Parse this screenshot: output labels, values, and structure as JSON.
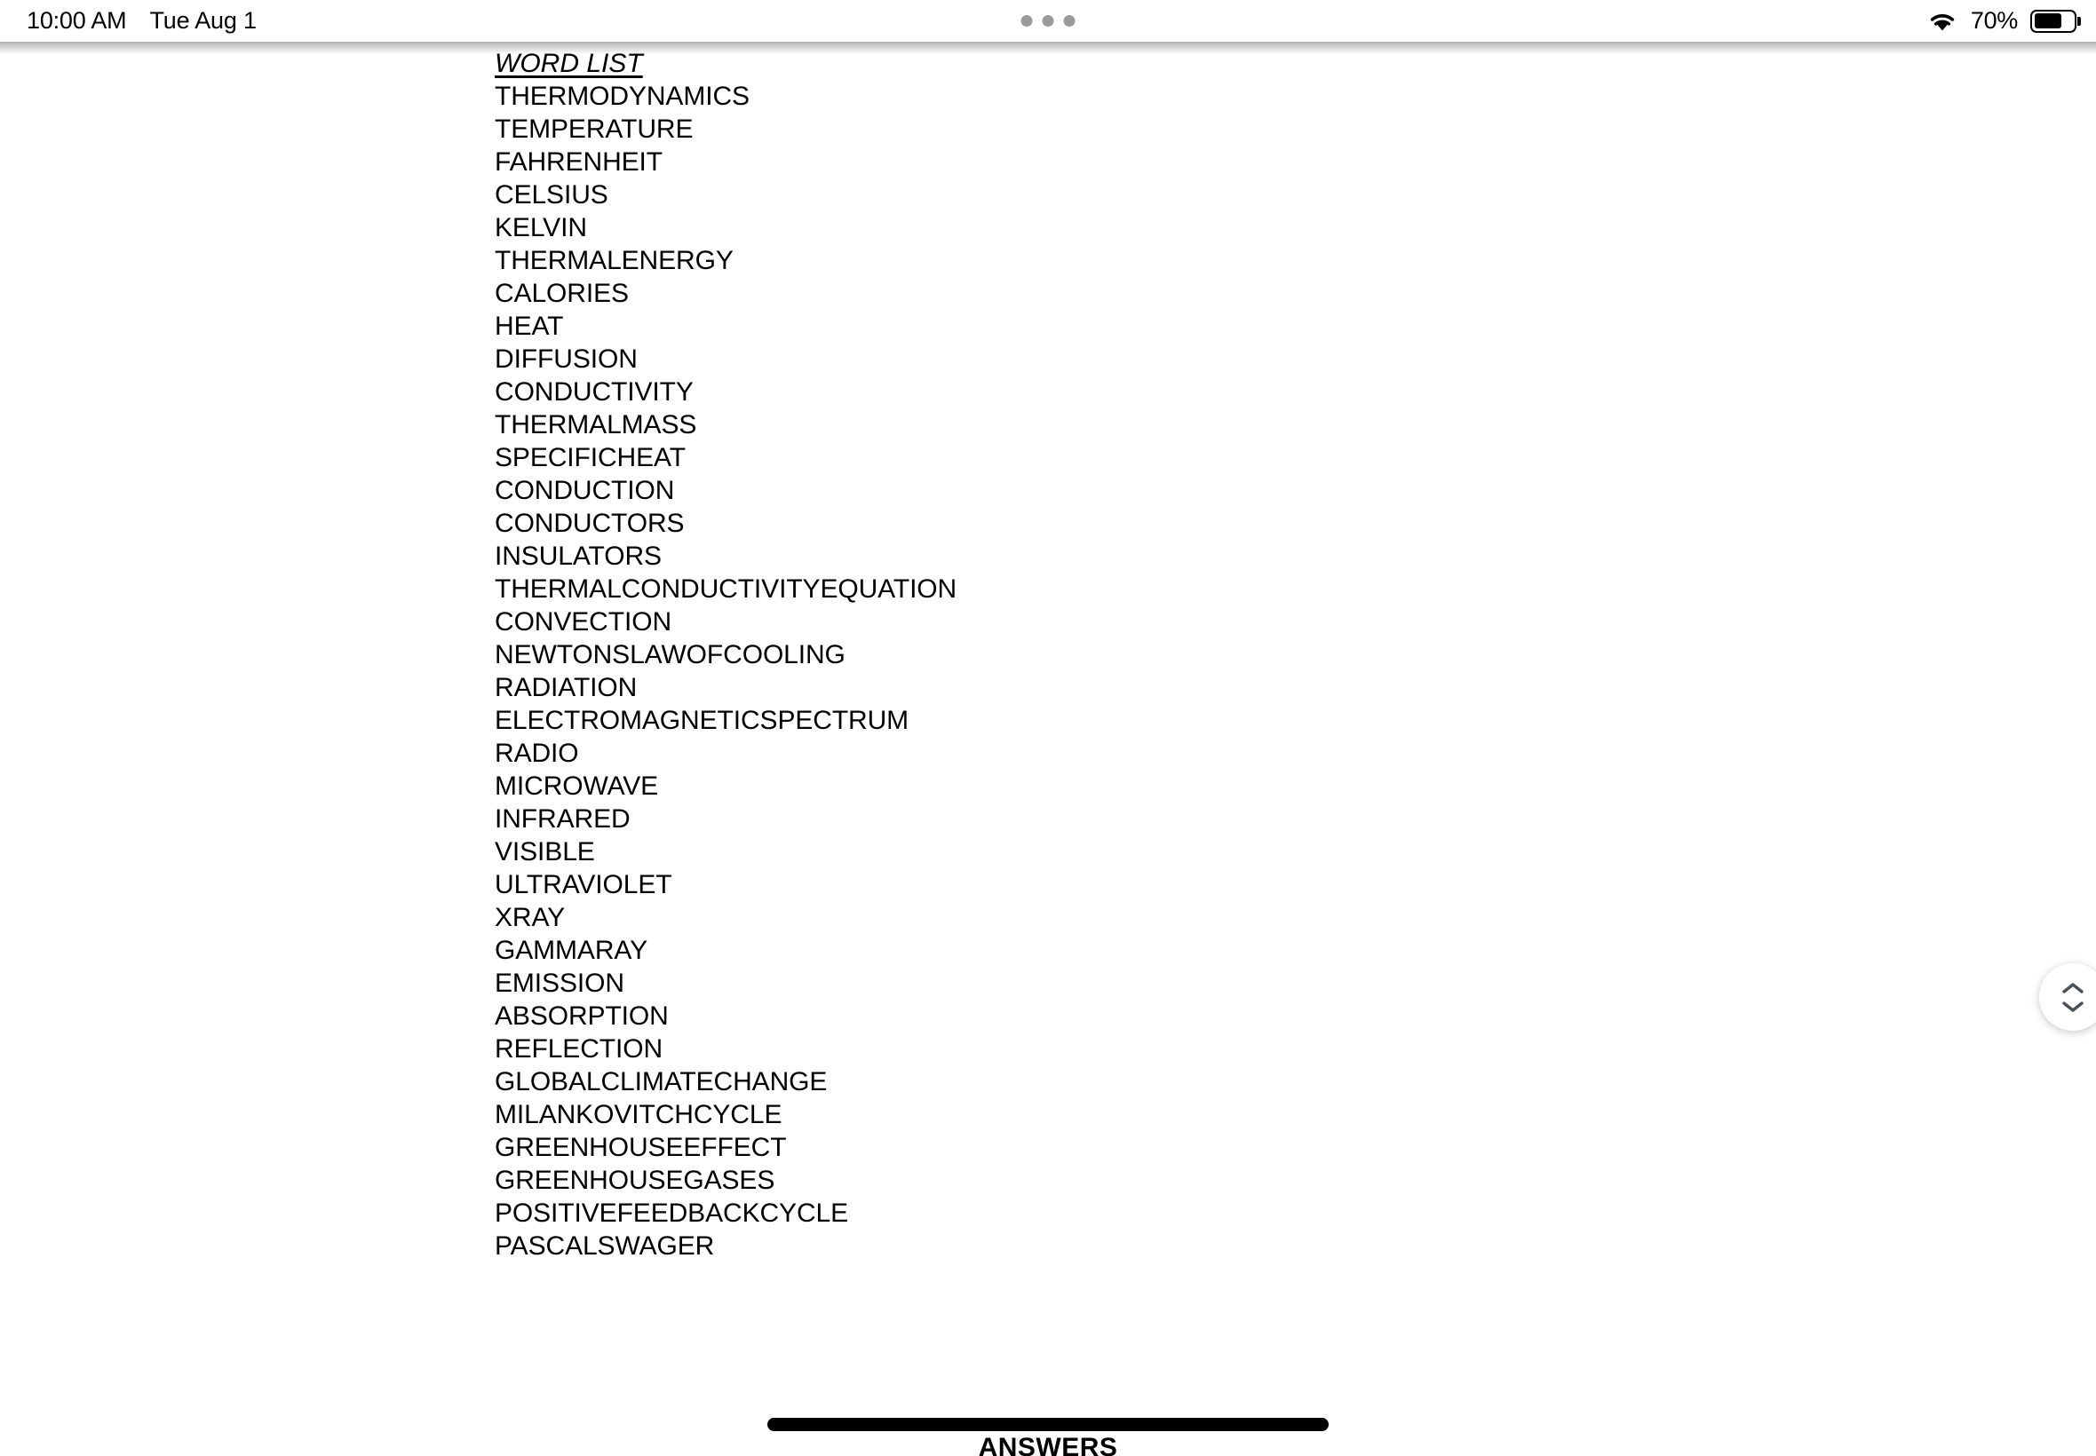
{
  "status_bar": {
    "time": "10:00 AM",
    "date": "Tue Aug 1",
    "battery_percent": "70%",
    "battery_level": 70,
    "wifi_icon": "wifi-icon",
    "battery_icon": "battery-icon",
    "multitask_handle": "three-dots-handle"
  },
  "document": {
    "title": "WORD LIST",
    "words": [
      "THERMODYNAMICS",
      "TEMPERATURE",
      "FAHRENHEIT",
      "CELSIUS",
      "KELVIN",
      "THERMALENERGY",
      "CALORIES",
      "HEAT",
      "DIFFUSION",
      "CONDUCTIVITY",
      "THERMALMASS",
      "SPECIFICHEAT",
      "CONDUCTION",
      "CONDUCTORS",
      "INSULATORS",
      "THERMALCONDUCTIVITYEQUATION",
      "CONVECTION",
      "NEWTONSLAWOFCOOLING",
      "RADIATION",
      "ELECTROMAGNETICSPECTRUM",
      "RADIO",
      "MICROWAVE",
      "INFRARED",
      "VISIBLE",
      "ULTRAVIOLET",
      "XRAY",
      "GAMMARAY",
      "EMISSION",
      "ABSORPTION",
      "REFLECTION",
      "GLOBALCLIMATECHANGE",
      "MILANKOVITCHCYCLE",
      "GREENHOUSEEFFECT",
      "GREENHOUSEGASES",
      "POSITIVEFEEDBACKCYCLE",
      "PASCALSWAGER"
    ],
    "next_section_heading": "ANSWERS"
  },
  "scroll_control": {
    "up_icon": "chevron-up-icon",
    "down_icon": "chevron-down-icon"
  },
  "colors": {
    "background": "#ffffff",
    "text": "#000000",
    "dot_gray": "#9a9a9a",
    "home_indicator": "#000000"
  }
}
